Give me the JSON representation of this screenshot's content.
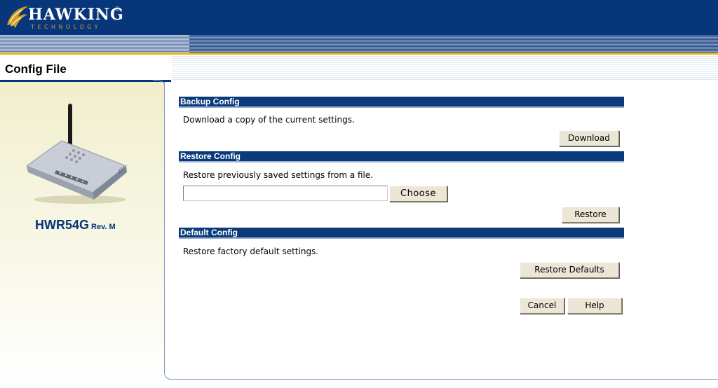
{
  "brand": {
    "name": "HAWKING",
    "registered": "®",
    "subtitle": "TECHNOLOGY"
  },
  "page": {
    "title": "Config File"
  },
  "device": {
    "model": "HWR54G",
    "revision": "Rev. M"
  },
  "sections": {
    "backup": {
      "title": "Backup Config",
      "description": "Download a copy of the current settings.",
      "button": "Download"
    },
    "restore": {
      "title": "Restore Config",
      "description": "Restore previously saved settings from a file.",
      "file_value": "",
      "choose_button": "Choose",
      "button": "Restore"
    },
    "defaults": {
      "title": "Default Config",
      "description": "Restore factory default settings.",
      "button": "Restore Defaults"
    }
  },
  "footer": {
    "cancel": "Cancel",
    "help": "Help"
  },
  "colors": {
    "header_blue": "#08367a",
    "accent_gold": "#e6b422",
    "section_bar": "#0a3a7c",
    "button_face": "#ebe6d6"
  },
  "icons": {
    "logo": "hawk-logo-icon",
    "device": "router-image"
  }
}
